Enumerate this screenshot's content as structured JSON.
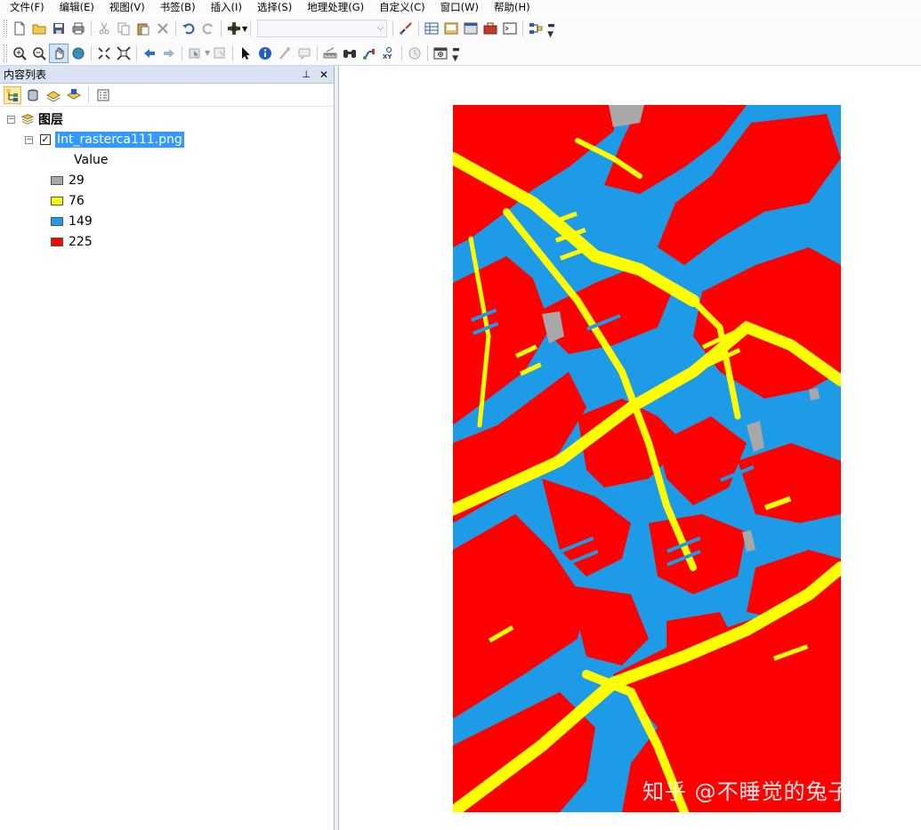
{
  "menubar": {
    "items": [
      "文件(F)",
      "编辑(E)",
      "视图(V)",
      "书签(B)",
      "插入(I)",
      "选择(S)",
      "地理处理(G)",
      "自定义(C)",
      "窗口(W)",
      "帮助(H)"
    ]
  },
  "toolbar1": {
    "icons": [
      "new-document-icon",
      "open-folder-icon",
      "save-icon",
      "print-icon",
      "cut-icon",
      "copy-icon",
      "paste-icon",
      "delete-icon",
      "undo-icon",
      "redo-icon",
      "add-data-icon",
      "scale-combo",
      "editor-toolbar-icon",
      "table-window-icon",
      "catalog-icon",
      "search-window-icon",
      "arctoolbox-icon",
      "python-window-icon",
      "model-builder-icon"
    ],
    "scale_value": ""
  },
  "toolbar2": {
    "icons": [
      "zoom-in-icon",
      "zoom-out-icon",
      "pan-icon",
      "full-extent-icon",
      "fixed-zoom-in-icon",
      "fixed-zoom-out-icon",
      "back-icon",
      "forward-icon",
      "select-features-icon",
      "clear-selection-icon",
      "select-elements-icon",
      "identify-icon",
      "hyperlink-icon",
      "html-popup-icon",
      "measure-icon",
      "find-icon",
      "find-route-icon",
      "go-to-xy-icon",
      "time-slider-icon",
      "create-viewer-icon"
    ]
  },
  "toc": {
    "title": "内容列表",
    "pin": "ꟷ",
    "close": "✕",
    "group_label": "图层",
    "layer": {
      "name": "Int_rasterca111.png",
      "checked": true,
      "field": "Value"
    },
    "legend": [
      {
        "label": "29",
        "color": "#a8a8a8"
      },
      {
        "label": "76",
        "color": "#ffff00"
      },
      {
        "label": "149",
        "color": "#1e9be6"
      },
      {
        "label": "225",
        "color": "#ff0000"
      }
    ]
  },
  "map": {
    "colors": {
      "road": "#ffff00",
      "water": "#1e9be6",
      "building": "#ff0000",
      "other": "#a8a8a8"
    },
    "watermark": "知乎 @不睡觉的兔子"
  }
}
